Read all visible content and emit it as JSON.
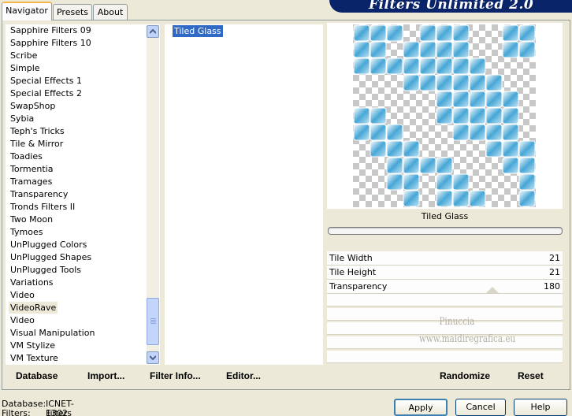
{
  "tabs": [
    {
      "label": "Navigator",
      "active": true
    },
    {
      "label": "Presets",
      "active": false
    },
    {
      "label": "About",
      "active": false
    }
  ],
  "banner": {
    "title": "Filters Unlimited 2.0"
  },
  "categories": [
    "Sapphire Filters 09",
    "Sapphire Filters 10",
    "Scribe",
    "Simple",
    "Special Effects 1",
    "Special Effects 2",
    "SwapShop",
    "Sybia",
    "Teph's Tricks",
    "Tile & Mirror",
    "Toadies",
    "Tormentia",
    "Tramages",
    "Transparency",
    "Tronds Filters II",
    "Two Moon",
    "Tymoes",
    "UnPlugged Colors",
    "UnPlugged Shapes",
    "UnPlugged Tools",
    "Variations",
    "Video",
    "VideoRave",
    "Video",
    "Visual Manipulation",
    "VM Stylize",
    "VM Texture"
  ],
  "highlighted_category": "VideoRave",
  "filters": [
    "Tiled Glass"
  ],
  "preview": {
    "label": "Tiled Glass",
    "accent": "#4aa8d8"
  },
  "params": [
    {
      "name": "Tile Width",
      "value": "21"
    },
    {
      "name": "Tile Height",
      "value": "21"
    },
    {
      "name": "Transparency",
      "value": "180"
    }
  ],
  "watermark": {
    "line1": "Pinuccia",
    "line2": "www.maidiregrafica.eu"
  },
  "toolbar": {
    "database": "Database",
    "import": "Import...",
    "filter_info": "Filter Info...",
    "editor": "Editor...",
    "randomize": "Randomize",
    "reset": "Reset"
  },
  "status": {
    "database_label": "Database:",
    "database_value": "ICNET-Filters",
    "filters_label": "Filters:",
    "filters_value": "1302"
  },
  "buttons": {
    "apply": "Apply",
    "cancel": "Cancel",
    "help": "Help"
  }
}
